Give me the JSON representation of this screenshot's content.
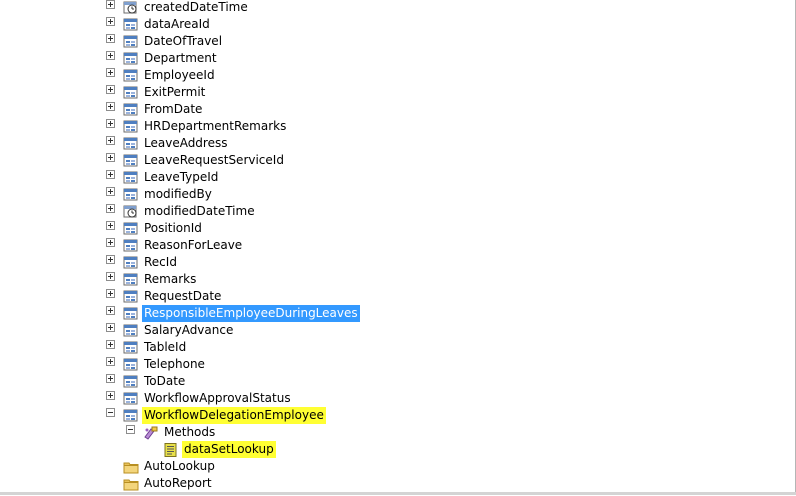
{
  "fields": [
    {
      "label": "createdDateTime",
      "icon": "datetime-field-icon"
    },
    {
      "label": "dataAreaId",
      "icon": "field-icon"
    },
    {
      "label": "DateOfTravel",
      "icon": "field-icon"
    },
    {
      "label": "Department",
      "icon": "field-icon"
    },
    {
      "label": "EmployeeId",
      "icon": "field-icon"
    },
    {
      "label": "ExitPermit",
      "icon": "field-icon"
    },
    {
      "label": "FromDate",
      "icon": "field-icon"
    },
    {
      "label": "HRDepartmentRemarks",
      "icon": "field-icon"
    },
    {
      "label": "LeaveAddress",
      "icon": "field-icon"
    },
    {
      "label": "LeaveRequestServiceId",
      "icon": "field-icon"
    },
    {
      "label": "LeaveTypeId",
      "icon": "field-icon"
    },
    {
      "label": "modifiedBy",
      "icon": "field-icon"
    },
    {
      "label": "modifiedDateTime",
      "icon": "datetime-field-icon"
    },
    {
      "label": "PositionId",
      "icon": "field-icon"
    },
    {
      "label": "ReasonForLeave",
      "icon": "field-icon"
    },
    {
      "label": "RecId",
      "icon": "field-icon"
    },
    {
      "label": "Remarks",
      "icon": "field-icon"
    },
    {
      "label": "RequestDate",
      "icon": "field-icon"
    },
    {
      "label": "ResponsibleEmployeeDuringLeaves",
      "icon": "field-icon",
      "state": "selected"
    },
    {
      "label": "SalaryAdvance",
      "icon": "field-icon"
    },
    {
      "label": "TableId",
      "icon": "field-icon"
    },
    {
      "label": "Telephone",
      "icon": "field-icon"
    },
    {
      "label": "ToDate",
      "icon": "field-icon"
    },
    {
      "label": "WorkflowApprovalStatus",
      "icon": "field-icon"
    },
    {
      "label": "WorkflowDelegationEmployee",
      "icon": "field-icon",
      "state": "highlighted",
      "expanded": true
    }
  ],
  "methods_node": {
    "label": "Methods",
    "icon": "methods-icon",
    "expanded": true
  },
  "method_items": [
    {
      "label": "dataSetLookup",
      "icon": "method-icon",
      "state": "highlighted"
    }
  ],
  "folders": [
    {
      "label": "AutoLookup",
      "icon": "folder-icon"
    },
    {
      "label": "AutoReport",
      "icon": "folder-icon"
    }
  ],
  "colors": {
    "selection": "#3399ff",
    "highlight": "#ffff33",
    "folder": "#e8c25a",
    "field_icon": "#4f7fc0"
  }
}
